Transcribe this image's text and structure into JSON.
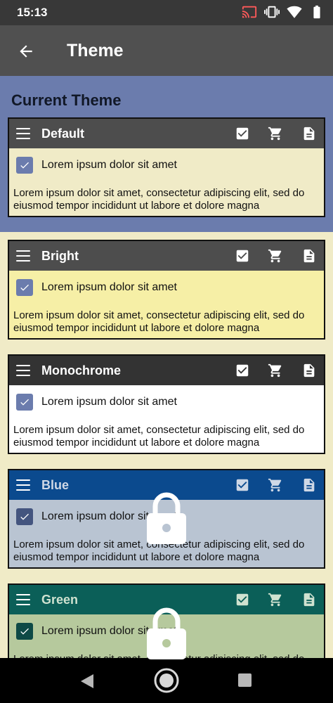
{
  "status": {
    "time": "15:13"
  },
  "app_bar": {
    "title": "Theme"
  },
  "current_section": {
    "title": "Current Theme"
  },
  "themes": [
    {
      "name": "Default",
      "header_bg": "#4d4d4d",
      "name_color": "#ffffff",
      "body_bg": "#f0ebc7",
      "checkbox_bg": "#6b7cad",
      "locked": false,
      "checkbox_label": "Lorem ipsum dolor sit amet",
      "paragraph": "Lorem ipsum dolor sit amet, consectetur adipiscing elit, sed do eiusmod tempor incididunt ut labore et dolore magna"
    },
    {
      "name": "Bright",
      "header_bg": "#4d4d4d",
      "name_color": "#ffffff",
      "body_bg": "#f6efa6",
      "checkbox_bg": "#6b7cad",
      "locked": false,
      "checkbox_label": "Lorem ipsum dolor sit amet",
      "paragraph": "Lorem ipsum dolor sit amet, consectetur adipiscing elit, sed do eiusmod tempor incididunt ut labore et dolore magna"
    },
    {
      "name": "Monochrome",
      "header_bg": "#333333",
      "name_color": "#ffffff",
      "body_bg": "#ffffff",
      "checkbox_bg": "#6b7cad",
      "locked": false,
      "checkbox_label": "Lorem ipsum dolor sit amet",
      "paragraph": "Lorem ipsum dolor sit amet, consectetur adipiscing elit, sed do eiusmod tempor incididunt ut labore et dolore magna"
    },
    {
      "name": "Blue",
      "header_bg": "#0b4a8e",
      "name_color": "#cfd8e6",
      "body_bg": "#b9c4d2",
      "checkbox_bg": "#44557f",
      "locked": true,
      "checkbox_label": "Lorem ipsum dolor sit amet",
      "paragraph": "Lorem ipsum dolor sit amet, consectetur adipiscing elit, sed do eiusmod tempor incididunt ut labore et dolore magna"
    },
    {
      "name": "Green",
      "header_bg": "#0b5f58",
      "name_color": "#cfe2d0",
      "body_bg": "#b6c99d",
      "checkbox_bg": "#0e4a46",
      "locked": true,
      "checkbox_label": "Lorem ipsum dolor sit amet",
      "paragraph": "Lorem ipsum dolor sit amet, consectetur adipiscing elit, sed do eiusmod tempor incididunt ut labore et dolore magna"
    }
  ],
  "colors": {
    "current_section_bg": "#6b7cad",
    "page_bg": "#f0ebc7",
    "app_bar_bg": "#505050"
  }
}
